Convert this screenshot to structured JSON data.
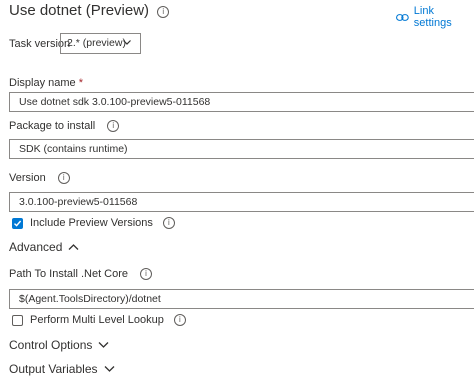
{
  "header": {
    "title": "Use dotnet (Preview)",
    "link_settings": "Link settings"
  },
  "task_version": {
    "label": "Task version",
    "value": "2.* (preview)"
  },
  "display_name": {
    "label": "Display name",
    "required_mark": "*",
    "value": "Use dotnet sdk 3.0.100-preview5-011568"
  },
  "package": {
    "label": "Package to install",
    "value": "SDK (contains runtime)"
  },
  "version": {
    "label": "Version",
    "value": "3.0.100-preview5-011568"
  },
  "include_preview": {
    "label": "Include Preview Versions",
    "checked": true
  },
  "advanced": {
    "label": "Advanced",
    "install_path_label": "Path To Install .Net Core",
    "install_path_value": "$(Agent.ToolsDirectory)/dotnet",
    "multi_level_label": "Perform Multi Level Lookup",
    "multi_level_checked": false
  },
  "sections": {
    "control_options": "Control Options",
    "output_variables": "Output Variables"
  },
  "colors": {
    "accent": "#0078d4",
    "required": "#a4262c"
  }
}
